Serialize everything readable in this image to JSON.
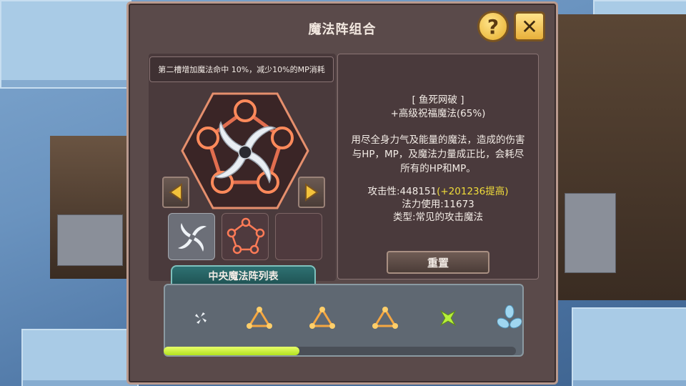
{
  "window": {
    "title": "魔法阵组合"
  },
  "buttons": {
    "help_glyph": "?",
    "close_glyph": "✕",
    "reset_label": "重置"
  },
  "buff": {
    "text": "第二槽增加魔法命中 10%，减少10%的MP消耗"
  },
  "skill": {
    "name": "[ 鱼死网破 ]",
    "rank": "+高级祝福魔法(65%)",
    "description": "用尽全身力气及能量的魔法，造成的伤害与HP，MP，及魔法力量成正比，会耗尽所有的HP和MP。",
    "attack_label": "攻击性:448151",
    "attack_bonus": "(+201236提高)",
    "mana_cost": "法力使用:11673",
    "type": "类型:常见的攻击魔法"
  },
  "list": {
    "tab_label": "中央魔法阵列表",
    "items": [
      {
        "icon": "small-swirl-icon"
      },
      {
        "icon": "triangle-ring-icon"
      },
      {
        "icon": "triangle-ring-icon"
      },
      {
        "icon": "triangle-ring-icon"
      },
      {
        "icon": "green-shuriken-icon"
      },
      {
        "icon": "blue-tri-blade-icon"
      }
    ],
    "scroll_position": 0.38
  },
  "colors": {
    "accent_gold": "#f0dc3a",
    "teal_tab": "#2e7172",
    "scroll_green": "#c5ef3a"
  }
}
